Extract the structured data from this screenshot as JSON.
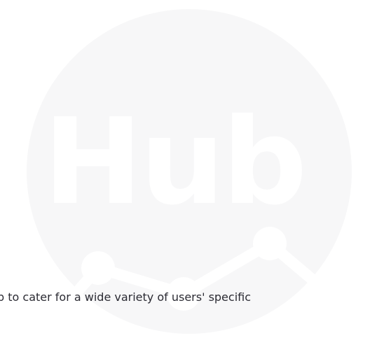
{
  "watermark": {
    "logo_text": "Hub",
    "circle_color": "#f7f7f8",
    "logo_color": "#ffffff",
    "graph_icon_color": "#ffffff"
  },
  "content": {
    "paragraph_line_1": "p to cater for a wide variety of users' specific",
    "paragraph_line_2": "",
    "text_color": "#2b2b33"
  }
}
